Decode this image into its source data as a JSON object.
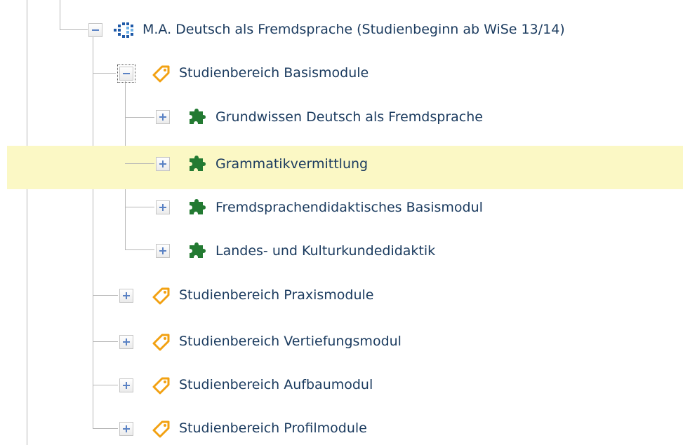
{
  "tree": {
    "root": {
      "label": "M.A. Deutsch als Fremdsprache (Studienbeginn ab WiSe 13/14)",
      "icon": "program-icon",
      "expanded": true
    },
    "areas": [
      {
        "label": "Studienbereich Basismodule",
        "icon": "tag-icon",
        "expanded": true,
        "modules": [
          {
            "label": "Grundwissen Deutsch als Fremdsprache",
            "icon": "puzzle-icon",
            "expanded": false,
            "selected": false
          },
          {
            "label": "Grammatikvermittlung",
            "icon": "puzzle-icon",
            "expanded": false,
            "selected": true
          },
          {
            "label": "Fremdsprachendidaktisches Basismodul",
            "icon": "puzzle-icon",
            "expanded": false,
            "selected": false
          },
          {
            "label": "Landes- und Kulturkundedidaktik",
            "icon": "puzzle-icon",
            "expanded": false,
            "selected": false
          }
        ]
      },
      {
        "label": "Studienbereich Praxismodule",
        "icon": "tag-icon",
        "expanded": false
      },
      {
        "label": "Studienbereich Vertiefungsmodul",
        "icon": "tag-icon",
        "expanded": false
      },
      {
        "label": "Studienbereich Aufbaumodul",
        "icon": "tag-icon",
        "expanded": false
      },
      {
        "label": "Studienbereich Profilmodule",
        "icon": "tag-icon",
        "expanded": false
      }
    ]
  },
  "colors": {
    "highlight": "#fbf8c5",
    "label_text": "#1a3a5e",
    "tag_icon": "#f2a112",
    "puzzle_icon": "#237a32",
    "program_icon": "#1f5aa8",
    "toggle_symbol": "#5a82c4"
  }
}
